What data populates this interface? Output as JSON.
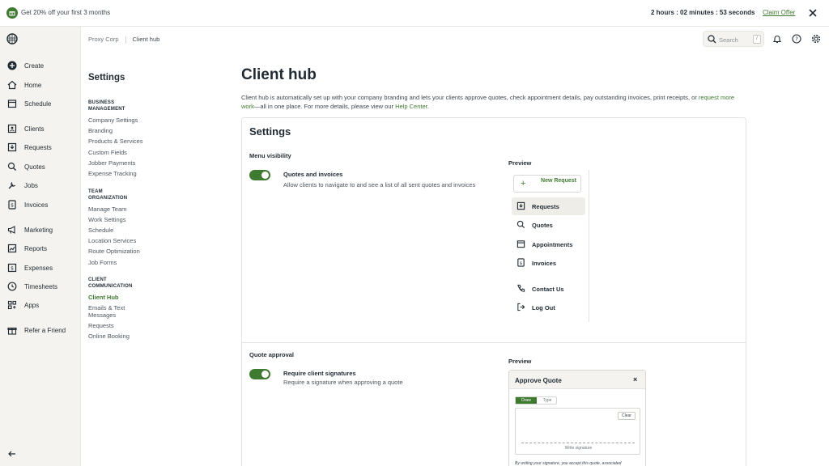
{
  "promo": {
    "text": "Get 20% off your first 3 months",
    "timer": "2 hours : 02 minutes : 53 seconds",
    "claim_label": "Claim Offer"
  },
  "nav": {
    "items": [
      {
        "label": "Create",
        "icon": "plus-circle-icon"
      },
      {
        "label": "Home",
        "icon": "home-icon"
      },
      {
        "label": "Schedule",
        "icon": "calendar-icon"
      },
      {
        "label": "Clients",
        "icon": "clients-icon"
      },
      {
        "label": "Requests",
        "icon": "requests-icon"
      },
      {
        "label": "Quotes",
        "icon": "quotes-icon"
      },
      {
        "label": "Jobs",
        "icon": "jobs-icon"
      },
      {
        "label": "Invoices",
        "icon": "invoices-icon"
      },
      {
        "label": "Marketing",
        "icon": "megaphone-icon"
      },
      {
        "label": "Reports",
        "icon": "reports-icon"
      },
      {
        "label": "Expenses",
        "icon": "expenses-icon"
      },
      {
        "label": "Timesheets",
        "icon": "clock-icon"
      },
      {
        "label": "Apps",
        "icon": "apps-icon"
      },
      {
        "label": "Refer a Friend",
        "icon": "gift-icon"
      }
    ]
  },
  "breadcrumb": {
    "company": "Proxy Corp",
    "current": "Client hub"
  },
  "search": {
    "placeholder": "Search",
    "shortcut": "/"
  },
  "settings_nav": {
    "title": "Settings",
    "sections": [
      {
        "title": "BUSINESS MANAGEMENT",
        "links": [
          "Company Settings",
          "Branding",
          "Products & Services",
          "Custom Fields",
          "Jobber Payments",
          "Expense Tracking"
        ]
      },
      {
        "title": "TEAM ORGANIZATION",
        "links": [
          "Manage Team",
          "Work Settings",
          "Schedule",
          "Location Services",
          "Route Optimization",
          "Job Forms"
        ]
      },
      {
        "title": "CLIENT COMMUNICATION",
        "links": [
          "Client Hub",
          "Emails & Text Messages",
          "Requests",
          "Online Booking"
        ]
      }
    ],
    "active": "Client Hub"
  },
  "main": {
    "title": "Client hub",
    "desc_before": "Client hub is automatically set up with your company branding and lets your clients approve quotes, check appointment details, pay outstanding invoices, print receipts, or ",
    "desc_link1": "request more work",
    "desc_middle": "—all in one place. For more details, please view our ",
    "desc_link2": "Help Center",
    "desc_after": "."
  },
  "card": {
    "title": "Settings",
    "menu_visibility": {
      "label": "Menu visibility",
      "option_title": "Quotes and invoices",
      "option_desc": "Allow clients to navigate to and see a list of all sent quotes and invoices",
      "enabled": true
    },
    "preview_label": "Preview",
    "preview_menu": {
      "new_request": "New Request",
      "items": [
        {
          "label": "Requests",
          "icon": "requests-icon",
          "selected": true
        },
        {
          "label": "Quotes",
          "icon": "quotes-icon"
        },
        {
          "label": "Appointments",
          "icon": "calendar-icon"
        },
        {
          "label": "Invoices",
          "icon": "invoices-icon"
        },
        {
          "label": "Contact Us",
          "icon": "phone-icon"
        },
        {
          "label": "Log Out",
          "icon": "logout-icon"
        }
      ]
    },
    "quote_approval": {
      "label": "Quote approval",
      "option_title": "Require client signatures",
      "option_desc": "Require a signature when approving a quote",
      "enabled": true
    },
    "approve_quote": {
      "title": "Approve Quote",
      "close": "×",
      "tab_draw": "Draw",
      "tab_type": "Type",
      "clear": "Clear",
      "write_signature": "Write signature",
      "note": "By writing your signature, you accept this quote, associated"
    }
  },
  "colors": {
    "accent": "#3f7a31",
    "sidebar_bg": "#f4f3ef",
    "text": "#1f2a33"
  }
}
